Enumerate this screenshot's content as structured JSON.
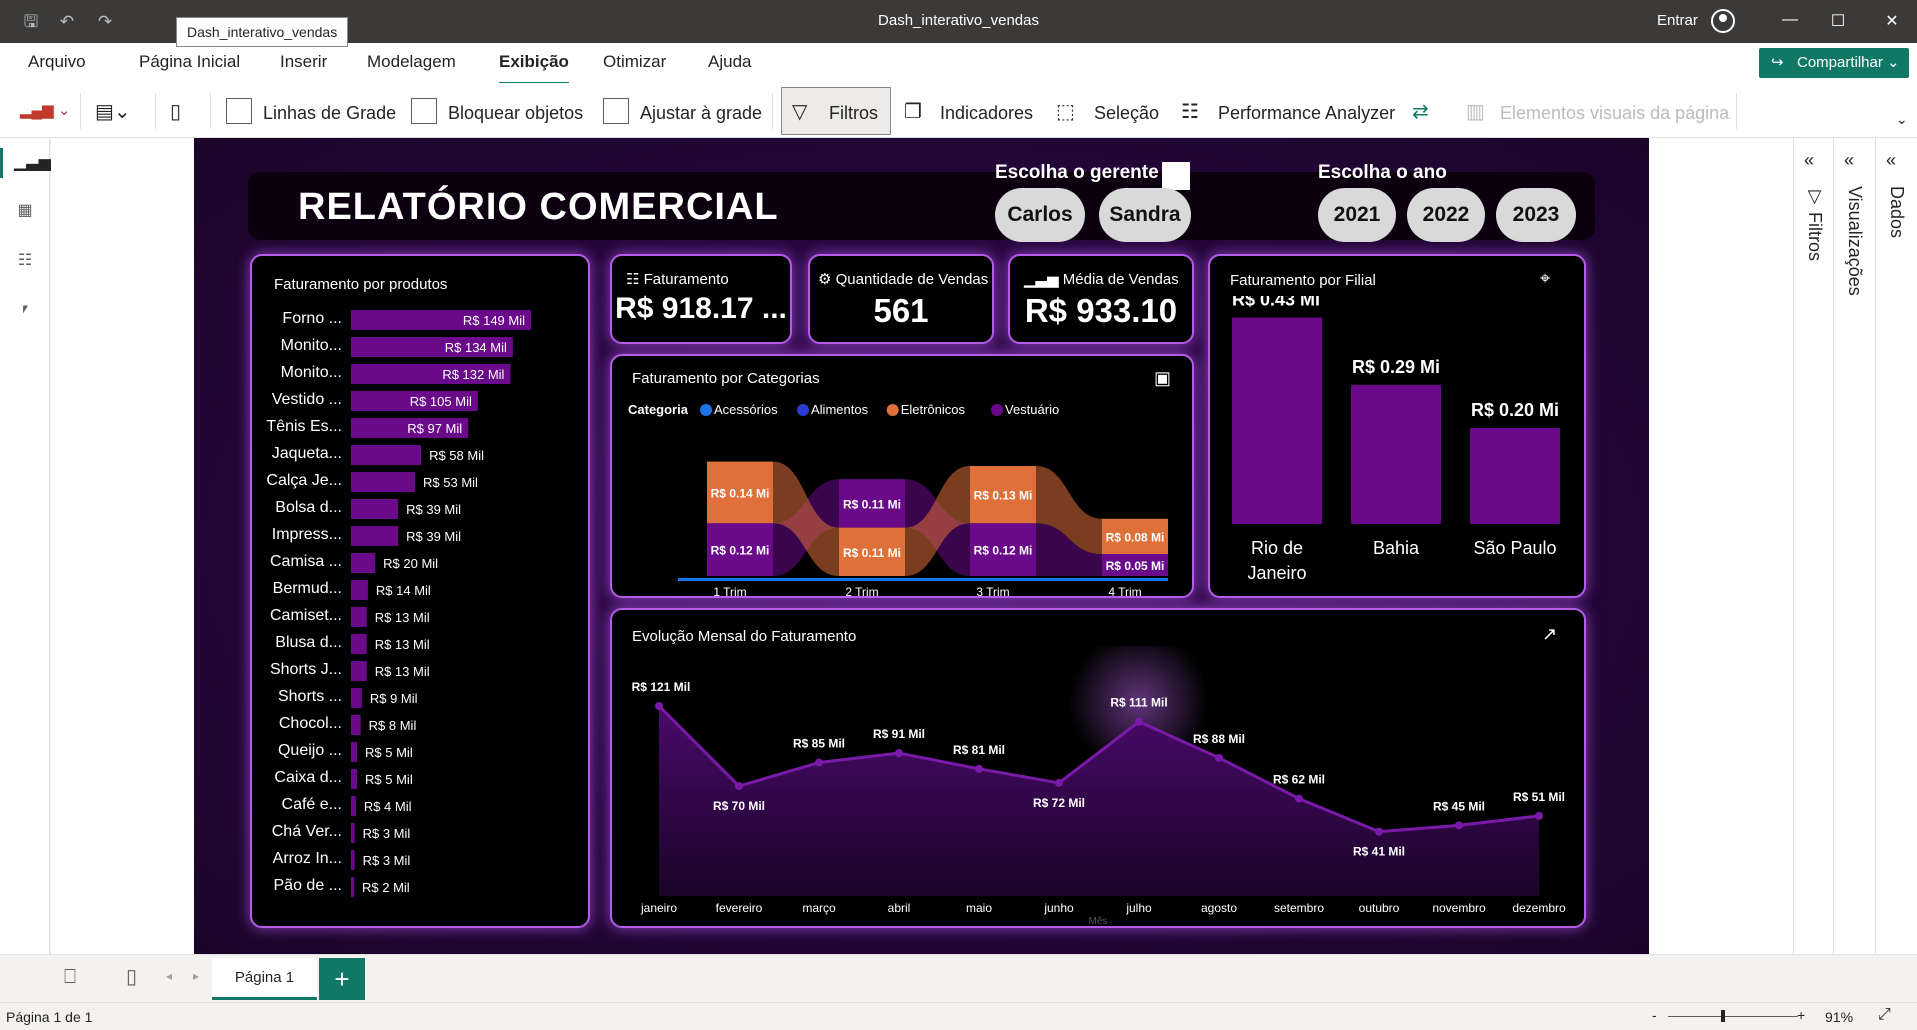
{
  "app": {
    "window_title": "Dash_interativo_vendas",
    "tooltip": "Dash_interativo_vendas",
    "signin": "Entrar",
    "menu": [
      "Arquivo",
      "Página Inicial",
      "Inserir",
      "Modelagem",
      "Exibição",
      "Otimizar",
      "Ajuda"
    ],
    "active_menu": "Exibição",
    "share": "Compartilhar",
    "accent": "#117865"
  },
  "toolbar": {
    "gridlines": "Linhas de Grade",
    "lock_objects": "Bloquear objetos",
    "snap_grid": "Ajustar à grade",
    "filters": "Filtros",
    "bookmarks": "Indicadores",
    "selection": "Seleção",
    "performance": "Performance Analyzer",
    "page_visuals": "Elementos visuais da página"
  },
  "right_panes": [
    "Filtros",
    "Visualizações",
    "Dados"
  ],
  "page_tab": "Página 1",
  "status": {
    "page_info": "Página 1 de 1",
    "zoom": "91%"
  },
  "report": {
    "title": "RELATÓRIO COMERCIAL",
    "manager_label": "Escolha o gerente",
    "managers": [
      "Carlos",
      "Sandra"
    ],
    "year_label": "Escolha o ano",
    "years": [
      "2021",
      "2022",
      "2023"
    ],
    "kpis": [
      {
        "title": "Faturamento",
        "value": "R$ 918.17 ..."
      },
      {
        "title": "Quantidade de Vendas",
        "value": "561"
      },
      {
        "title": "Média de Vendas",
        "value": "R$ 933.10"
      }
    ],
    "colors": {
      "purple": "#6a0a8a",
      "orange": "#e0703a",
      "border": "#b45ce8"
    }
  },
  "chart_data": [
    {
      "type": "bar",
      "title": "Faturamento por produtos",
      "orientation": "horizontal",
      "categories": [
        "Forno ...",
        "Monito...",
        "Monito...",
        "Vestido ...",
        "Tênis Es...",
        "Jaqueta...",
        "Calça Je...",
        "Bolsa d...",
        "Impress...",
        "Camisa ...",
        "Bermud...",
        "Camiset...",
        "Blusa d...",
        "Shorts J...",
        "Shorts ...",
        "Chocol...",
        "Queijo ...",
        "Caixa d...",
        "Café e...",
        "Chá Ver...",
        "Arroz In...",
        "Pão de ..."
      ],
      "values": [
        149,
        134,
        132,
        105,
        97,
        58,
        53,
        39,
        39,
        20,
        14,
        13,
        13,
        13,
        9,
        8,
        5,
        5,
        4,
        3,
        3,
        2
      ],
      "labels": [
        "R$ 149 Mil",
        "R$ 134 Mil",
        "R$ 132 Mil",
        "R$ 105 Mil",
        "R$ 97 Mil",
        "R$ 58 Mil",
        "R$ 53 Mil",
        "R$ 39 Mil",
        "R$ 39 Mil",
        "R$ 20 Mil",
        "R$ 14 Mil",
        "R$ 13 Mil",
        "R$ 13 Mil",
        "R$ 13 Mil",
        "R$ 9 Mil",
        "R$ 8 Mil",
        "R$ 5 Mil",
        "R$ 5 Mil",
        "R$ 4 Mil",
        "R$ 3 Mil",
        "R$ 3 Mil",
        "R$ 2 Mil"
      ]
    },
    {
      "type": "area",
      "title": "Faturamento por Categorias",
      "subtype": "ribbon",
      "legend_title": "Categoria",
      "legend": [
        {
          "name": "Acessórios",
          "color": "#1a73e8"
        },
        {
          "name": "Alimentos",
          "color": "#2a3bd6"
        },
        {
          "name": "Eletrônicos",
          "color": "#e0703a"
        },
        {
          "name": "Vestuário",
          "color": "#6a0a8a"
        }
      ],
      "xlabel": "Trim",
      "categories": [
        "1 Trim",
        "2 Trim",
        "3 Trim",
        "4 Trim"
      ],
      "series": [
        {
          "name": "Eletrônicos",
          "values": [
            0.14,
            0.11,
            0.13,
            0.08
          ],
          "labels": [
            "R$ 0.14 Mi",
            "R$ 0.11 Mi",
            "R$ 0.13 Mi",
            "R$ 0.08 Mi"
          ]
        },
        {
          "name": "Vestuário",
          "values": [
            0.12,
            0.11,
            0.12,
            0.05
          ],
          "labels": [
            "R$ 0.12 Mi",
            "R$ 0.11 Mi",
            "R$ 0.12 Mi",
            "R$ 0.05 Mi"
          ]
        }
      ]
    },
    {
      "type": "bar",
      "title": "Faturamento por Filial",
      "categories": [
        "Rio de Janeiro",
        "Bahia",
        "São Paulo"
      ],
      "values": [
        0.43,
        0.29,
        0.2
      ],
      "labels": [
        "R$ 0.43 Mi",
        "R$ 0.29 Mi",
        "R$ 0.20 Mi"
      ]
    },
    {
      "type": "area",
      "title": "Evolução Mensal do Faturamento",
      "xlabel": "Mês",
      "categories": [
        "janeiro",
        "fevereiro",
        "março",
        "abril",
        "maio",
        "junho",
        "julho",
        "agosto",
        "setembro",
        "outubro",
        "novembro",
        "dezembro"
      ],
      "values": [
        121,
        70,
        85,
        91,
        81,
        72,
        111,
        88,
        62,
        41,
        45,
        51
      ],
      "labels": [
        "R$ 121 Mil",
        "R$ 70 Mil",
        "R$ 85 Mil",
        "R$ 91 Mil",
        "R$ 81 Mil",
        "R$ 72 Mil",
        "R$ 111 Mil",
        "R$ 88 Mil",
        "R$ 62 Mil",
        "R$ 41 Mil",
        "R$ 45 Mil",
        "R$ 51 Mil"
      ]
    }
  ]
}
